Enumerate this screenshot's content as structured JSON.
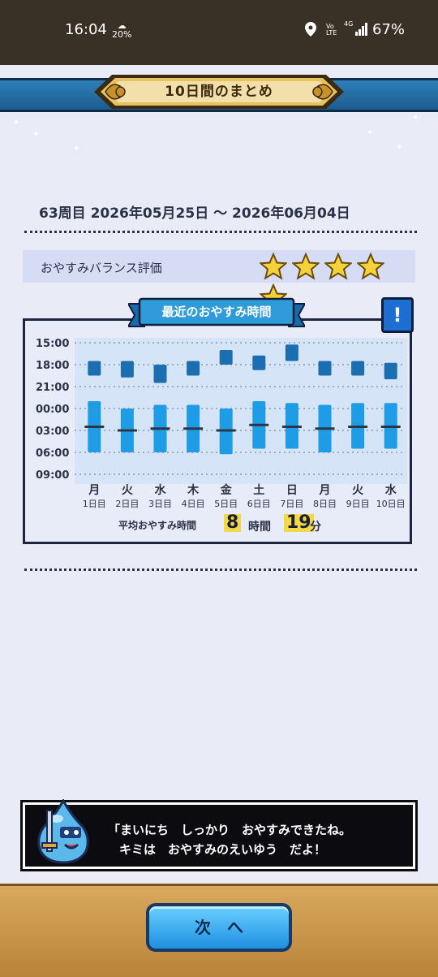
{
  "status": {
    "time": "16:04",
    "weather": "20%",
    "volte": "Vo\nLTE",
    "network": "4G",
    "battery": "67%"
  },
  "header": {
    "title": "10日間のまとめ"
  },
  "period": {
    "text": "63周目 2026年05月25日 ～ 2026年06月04日"
  },
  "balance": {
    "label": "おやすみバランス評価",
    "stars": 5
  },
  "chart_section": {
    "title": "最近のおやすみ時間",
    "info_icon": "!"
  },
  "chart_data": {
    "type": "range-bar",
    "y_ticks": [
      "15:00",
      "18:00",
      "21:00",
      "00:00",
      "03:00",
      "06:00",
      "09:00"
    ],
    "days": [
      {
        "weekday": "月",
        "day": "1日目",
        "meal_start": "17:30",
        "meal_end": "19:30",
        "sleep_start": "23:00",
        "sleep_end": "06:00",
        "mid": "02:30"
      },
      {
        "weekday": "火",
        "day": "2日目",
        "meal_start": "17:30",
        "meal_end": "19:45",
        "sleep_start": "00:00",
        "sleep_end": "06:00",
        "mid": "03:00"
      },
      {
        "weekday": "水",
        "day": "3日目",
        "meal_start": "18:00",
        "meal_end": "20:30",
        "sleep_start": "23:30",
        "sleep_end": "06:00",
        "mid": "02:45"
      },
      {
        "weekday": "木",
        "day": "4日目",
        "meal_start": "17:30",
        "meal_end": "19:30",
        "sleep_start": "23:30",
        "sleep_end": "06:00",
        "mid": "02:45"
      },
      {
        "weekday": "金",
        "day": "5日目",
        "meal_start": "16:00",
        "meal_end": "18:00",
        "sleep_start": "00:00",
        "sleep_end": "06:15",
        "mid": "03:00"
      },
      {
        "weekday": "土",
        "day": "6日目",
        "meal_start": "16:45",
        "meal_end": "18:45",
        "sleep_start": "23:00",
        "sleep_end": "05:30",
        "mid": "02:15"
      },
      {
        "weekday": "日",
        "day": "7日目",
        "meal_start": "15:15",
        "meal_end": "17:30",
        "sleep_start": "23:15",
        "sleep_end": "05:30",
        "mid": "02:30"
      },
      {
        "weekday": "月",
        "day": "8日目",
        "meal_start": "17:30",
        "meal_end": "19:30",
        "sleep_start": "23:30",
        "sleep_end": "06:00",
        "mid": "02:45"
      },
      {
        "weekday": "火",
        "day": "9日目",
        "meal_start": "17:30",
        "meal_end": "19:30",
        "sleep_start": "23:15",
        "sleep_end": "05:30",
        "mid": "02:30"
      },
      {
        "weekday": "水",
        "day": "10日目",
        "meal_start": "17:45",
        "meal_end": "20:00",
        "sleep_start": "23:15",
        "sleep_end": "05:30",
        "mid": "02:30"
      }
    ],
    "colors": {
      "sleep": "#1e9ce6",
      "meal": "#1b6fb0",
      "mid": "#2d3646",
      "plot_bg": "#d5e4f6"
    }
  },
  "average": {
    "label": "平均おやすみ時間",
    "hours": "8",
    "hours_unit": "時間",
    "minutes": "19",
    "minutes_unit": "分"
  },
  "message": {
    "line1": "「まいにち　しっかり　おやすみできたね。",
    "line2": "キミは　おやすみのえいゆう　だよ！"
  },
  "footer": {
    "next_label": "次　へ"
  },
  "colors": {
    "accent": "#1f8fe0",
    "status_bg": "#3a3126",
    "title_bar": "#2f7fb8",
    "star": "#f5d23a"
  }
}
